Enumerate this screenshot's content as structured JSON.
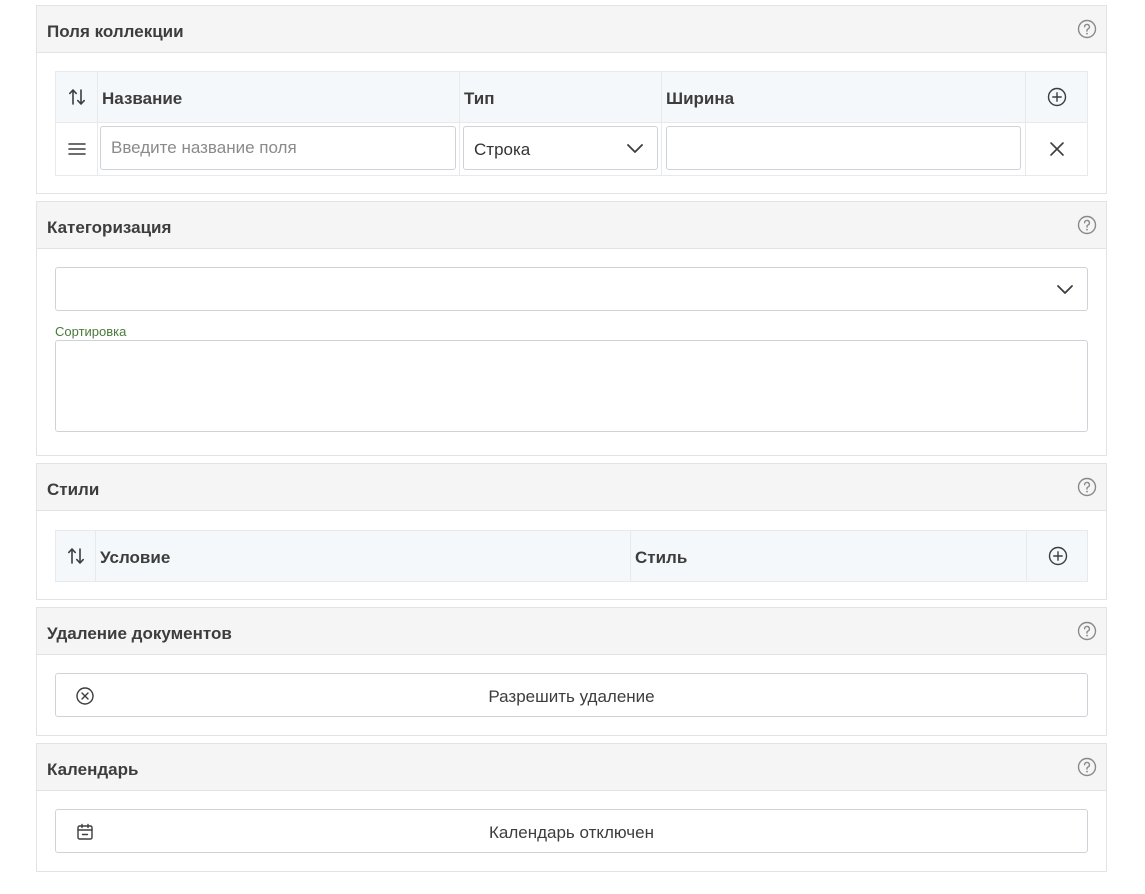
{
  "collection_fields": {
    "title": "Поля коллекции",
    "columns": {
      "name": "Название",
      "type": "Тип",
      "width": "Ширина"
    },
    "row": {
      "name_placeholder": "Введите название поля",
      "type_value": "Строка",
      "width_value": ""
    }
  },
  "categorization": {
    "title": "Категоризация",
    "select_value": "",
    "sort_label": "Сортировка",
    "sort_value": ""
  },
  "styles": {
    "title": "Стили",
    "columns": {
      "condition": "Условие",
      "style": "Стиль"
    }
  },
  "document_deletion": {
    "title": "Удаление документов",
    "button_label": "Разрешить удаление"
  },
  "calendar": {
    "title": "Календарь",
    "button_label": "Календарь отключен"
  },
  "icons": {
    "help": "help-circle-icon",
    "sort": "sort-arrows-icon",
    "add": "plus-circle-icon",
    "drag": "drag-handle-icon",
    "remove": "close-icon",
    "chevron": "chevron-down-icon",
    "forbidden": "x-circle-icon",
    "calendar": "calendar-icon"
  },
  "colors": {
    "header_bg": "#f5f5f5",
    "table_head_bg": "#f5f8fa",
    "label_green": "#4a7a3a"
  }
}
